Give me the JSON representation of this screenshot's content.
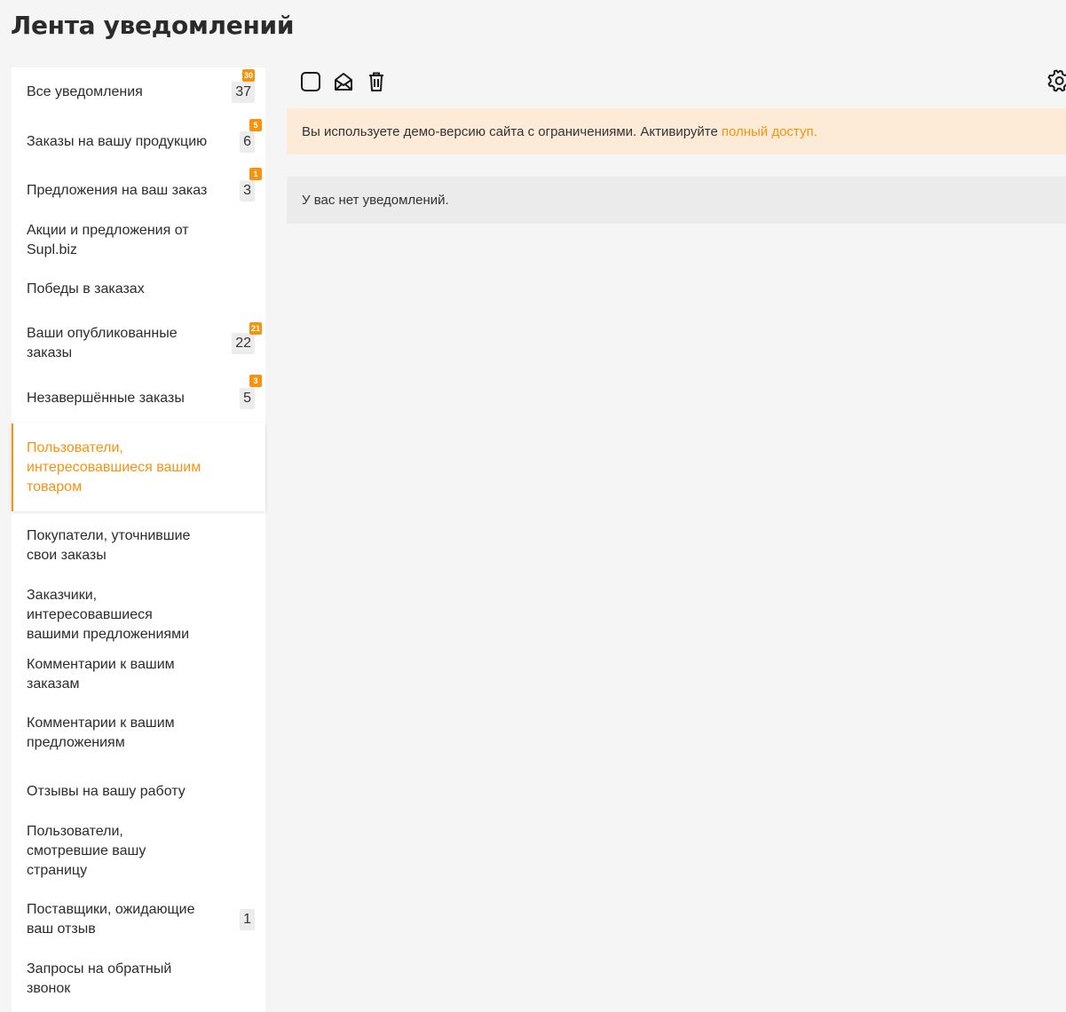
{
  "page": {
    "title": "Лента уведомлений"
  },
  "sidebar": {
    "items": [
      {
        "label": "Все уведомления",
        "count": "37",
        "badge": "30"
      },
      {
        "label": "Заказы на вашу продукцию",
        "count": "6",
        "badge": "5"
      },
      {
        "label": "Предложения на ваш заказ",
        "count": "3",
        "badge": "1"
      },
      {
        "label": "Акции и предложения от Supl.biz"
      },
      {
        "label": "Победы в заказах"
      },
      {
        "label": "Ваши опубликованные заказы",
        "count": "22",
        "badge": "21"
      },
      {
        "label": "Незавершённые заказы",
        "count": "5",
        "badge": "3"
      },
      {
        "label": "Пользователи, интересовавшиеся вашим товаром",
        "active": true
      },
      {
        "label": "Покупатели, уточнившие свои заказы"
      },
      {
        "label": "Заказчики, интересовавшиеся вашими предложениями"
      },
      {
        "label": "Комментарии к вашим заказам"
      },
      {
        "label": "Комментарии к вашим предложениям"
      },
      {
        "label": "Отзывы на вашу работу"
      },
      {
        "label": "Пользователи, смотревшие вашу страницу"
      },
      {
        "label": "Поставщики, ожидающие ваш отзыв",
        "count": "1"
      },
      {
        "label": "Запросы на обратный звонок"
      }
    ]
  },
  "toolbar": {
    "icons": [
      "select-all-checkbox-icon",
      "mark-read-envelope-icon",
      "trash-icon"
    ],
    "settings_icon": "gear-icon"
  },
  "banner": {
    "text": "Вы используете демо-версию сайта с ограничениями. Активируйте",
    "link_text": "полный доступ."
  },
  "empty": {
    "text": "У вас нет уведомлений."
  },
  "colors": {
    "accent": "#f7930e",
    "banner_bg": "#fdebd8",
    "empty_bg": "#ebebeb",
    "page_bg": "#f5f5f5"
  }
}
